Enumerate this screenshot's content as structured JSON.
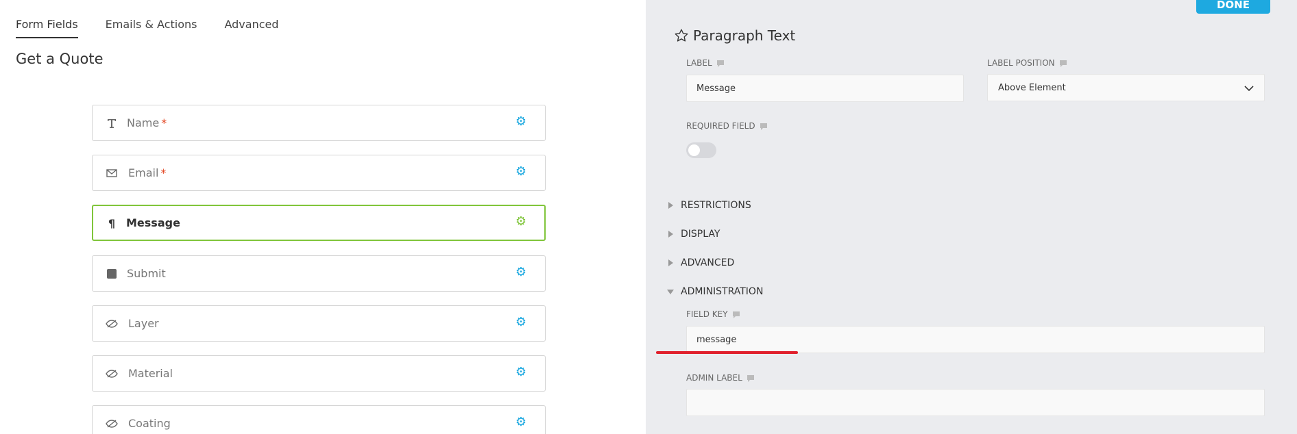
{
  "tabs": [
    {
      "label": "Form Fields",
      "active": true
    },
    {
      "label": "Emails & Actions",
      "active": false
    },
    {
      "label": "Advanced",
      "active": false
    }
  ],
  "form": {
    "title": "Get a Quote",
    "fields": [
      {
        "label": "Name",
        "required": "*",
        "icon": "text-icon"
      },
      {
        "label": "Email",
        "required": "*",
        "icon": "envelope-icon"
      },
      {
        "label": "Message",
        "required": "",
        "icon": "paragraph-icon"
      },
      {
        "label": "Submit",
        "required": "",
        "icon": "square-icon"
      },
      {
        "label": "Layer",
        "required": "",
        "icon": "eye-slash-icon"
      },
      {
        "label": "Material",
        "required": "",
        "icon": "eye-slash-icon"
      },
      {
        "label": "Coating",
        "required": "",
        "icon": "eye-slash-icon"
      }
    ]
  },
  "settings": {
    "done_label": "DONE",
    "title": "Paragraph Text",
    "label_label": "LABEL",
    "label_value": "Message",
    "label_position_label": "LABEL POSITION",
    "label_position_value": "Above Element",
    "required_label": "REQUIRED FIELD",
    "sections": [
      "RESTRICTIONS",
      "DISPLAY",
      "ADVANCED",
      "ADMINISTRATION"
    ],
    "field_key_label": "FIELD KEY",
    "field_key_value": "message",
    "admin_label_label": "ADMIN LABEL",
    "admin_label_value": ""
  },
  "colors": {
    "accent_blue": "#1ea9e0",
    "selected_green": "#80c53b",
    "required_red": "#e2401c",
    "highlight_red": "#e0202c",
    "panel_bg": "#ebecef"
  }
}
